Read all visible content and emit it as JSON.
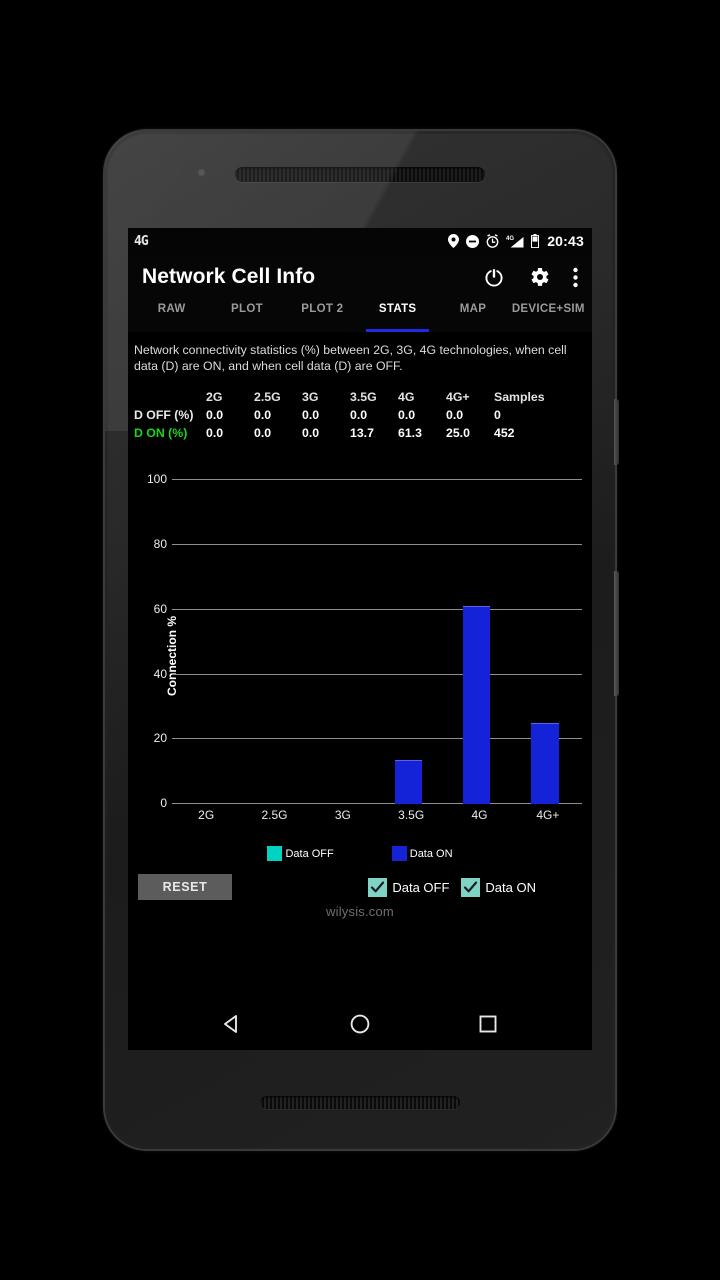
{
  "status_bar": {
    "network_badge": "4G",
    "time": "20:43",
    "icons": [
      "location-pin-icon",
      "do-not-disturb-icon",
      "alarm-clock-icon",
      "signal-4g-icon",
      "battery-icon"
    ]
  },
  "app_bar": {
    "title": "Network Cell Info",
    "actions": [
      "power-icon",
      "settings-gear-icon",
      "overflow-menu-icon"
    ]
  },
  "tabs": [
    {
      "label": "RAW",
      "active": false
    },
    {
      "label": "PLOT",
      "active": false
    },
    {
      "label": "PLOT 2",
      "active": false
    },
    {
      "label": "STATS",
      "active": true
    },
    {
      "label": "MAP",
      "active": false
    },
    {
      "label": "DEVICE+SIM",
      "active": false
    }
  ],
  "description": "Network connectivity statistics (%) between 2G, 3G, 4G technologies, when cell data (D) are ON, and when cell data (D) are OFF.",
  "table": {
    "columns": [
      "2G",
      "2.5G",
      "3G",
      "3.5G",
      "4G",
      "4G+",
      "Samples"
    ],
    "rows": [
      {
        "label": "D OFF (%)",
        "values": [
          "0.0",
          "0.0",
          "0.0",
          "0.0",
          "0.0",
          "0.0",
          "0"
        ]
      },
      {
        "label": "D ON (%)",
        "values": [
          "0.0",
          "0.0",
          "0.0",
          "13.7",
          "61.3",
          "25.0",
          "452"
        ]
      }
    ]
  },
  "chart_data": {
    "type": "bar",
    "title": "",
    "xlabel": "",
    "ylabel": "Connection %",
    "categories": [
      "2G",
      "2.5G",
      "3G",
      "3.5G",
      "4G",
      "4G+"
    ],
    "ylim": [
      0,
      100
    ],
    "yticks": [
      0,
      20,
      40,
      60,
      80,
      100
    ],
    "grid": true,
    "legend_position": "bottom",
    "series": [
      {
        "name": "Data OFF",
        "color": "#00d2c4",
        "values": [
          0.0,
          0.0,
          0.0,
          0.0,
          0.0,
          0.0
        ]
      },
      {
        "name": "Data ON",
        "color": "#1423d8",
        "values": [
          0.0,
          0.0,
          0.0,
          13.7,
          61.3,
          25.0
        ]
      }
    ]
  },
  "legend": [
    {
      "label": "Data OFF",
      "color": "#00d2c4"
    },
    {
      "label": "Data ON",
      "color": "#1423d8"
    }
  ],
  "controls": {
    "reset_label": "RESET",
    "checkboxes": [
      {
        "label": "Data OFF",
        "checked": true
      },
      {
        "label": "Data ON",
        "checked": true
      }
    ]
  },
  "watermark": "wilysis.com",
  "nav_bar": [
    "back-icon",
    "home-icon",
    "recents-icon"
  ],
  "colors": {
    "accent_blue": "#1a2de0",
    "bar_blue": "#1423d8",
    "cyan": "#00d2c4",
    "checkbox_teal": "#7fd4c4",
    "data_on_green": "#19d719"
  }
}
